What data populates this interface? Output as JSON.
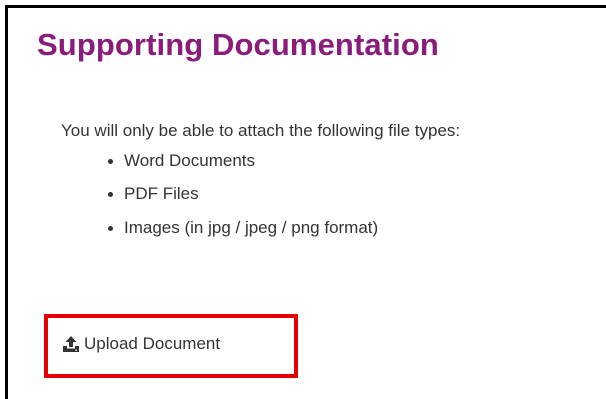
{
  "section": {
    "title": "Supporting Documentation",
    "intro": "You will only be able to attach the following file types:",
    "file_types": [
      "Word Documents",
      "PDF Files",
      "Images (in jpg / jpeg / png format)"
    ]
  },
  "upload": {
    "label": "Upload Document",
    "icon": "upload-icon",
    "highlight_color": "#e60000"
  },
  "colors": {
    "title": "#8a1c7c",
    "text": "#333333"
  }
}
